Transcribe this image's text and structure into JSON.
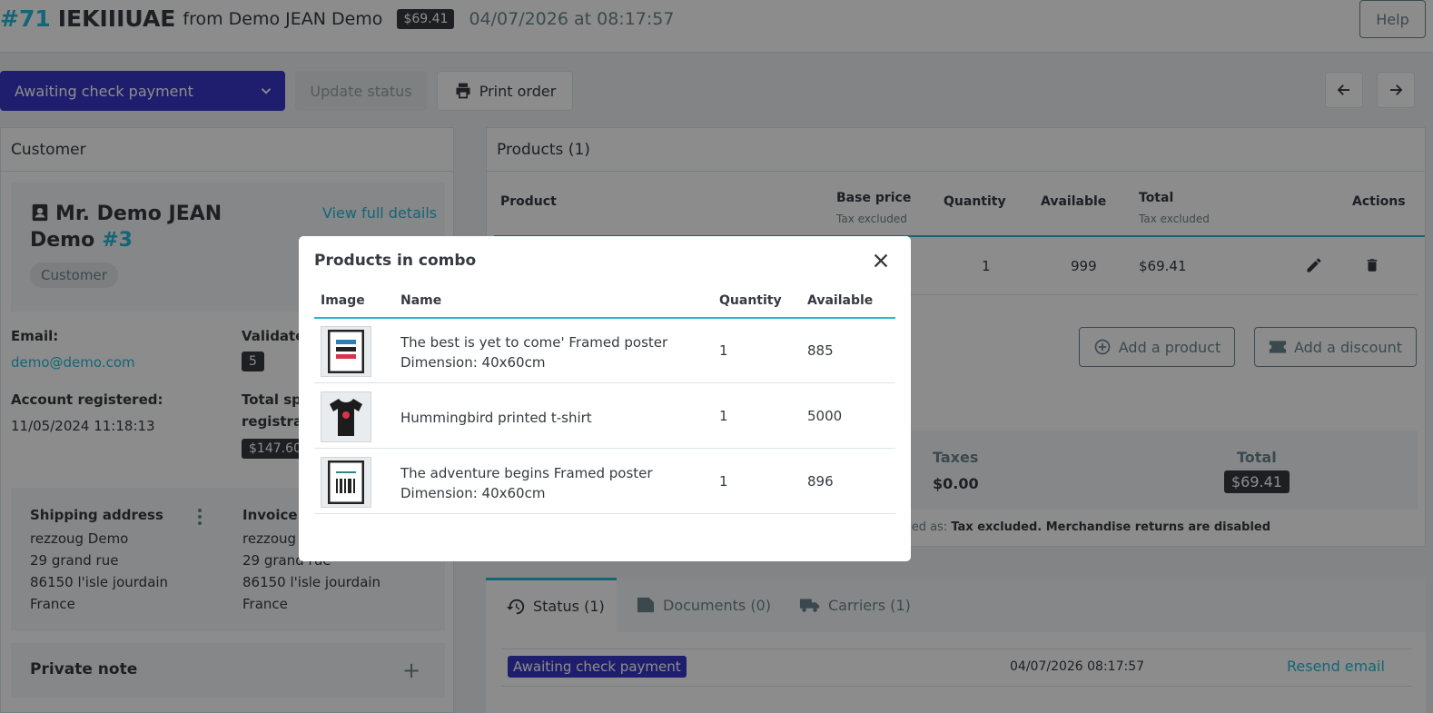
{
  "header": {
    "order_number": "#71",
    "order_reference": "IEKIIIUAE",
    "from_customer": "from Demo JEAN Demo",
    "total_badge": "$69.41",
    "date": "04/07/2026",
    "at_time": "at 08:17:57",
    "help_label": "Help"
  },
  "toolbar": {
    "status_value": "Awaiting check payment",
    "update_status_label": "Update status",
    "print_order_label": "Print order"
  },
  "customer": {
    "card_title": "Customer",
    "name": "Mr. Demo JEAN Demo",
    "id": "#3",
    "view_details": "View full details",
    "group_pill": "Customer",
    "email_label": "Email:",
    "email_value": "demo@demo.com",
    "validated_label": "Validate",
    "validated_value": "5",
    "registered_label": "Account registered:",
    "registered_value": "11/05/2024 11:18:13",
    "total_spent_label_1": "Total sp",
    "total_spent_label_2": "registra",
    "total_spent_value": "$147.60",
    "shipping_title": "Shipping address",
    "shipping_lines": [
      "rezzoug Demo",
      "29 grand rue",
      "86150 l'isle jourdain",
      "France"
    ],
    "invoice_title": "Invoice a",
    "invoice_lines": [
      "rezzoug",
      "29 grand rue",
      "86150 l'isle jourdain",
      "France"
    ],
    "private_note_title": "Private note"
  },
  "products": {
    "card_title": "Products (1)",
    "columns": {
      "product": "Product",
      "base_price": "Base price",
      "base_price_sub": "Tax excluded",
      "quantity": "Quantity",
      "available": "Available",
      "total": "Total",
      "total_sub": "Tax excluded",
      "actions": "Actions"
    },
    "row": {
      "quantity": "1",
      "available": "999",
      "total": "$69.41"
    },
    "add_product_label": "Add a product",
    "add_discount_label": "Add a discount",
    "taxes_label": "Taxes",
    "taxes_value": "$0.00",
    "total_label": "Total",
    "total_value": "$69.41",
    "tax_note_prefix": "yed as: ",
    "tax_note_bold": "Tax excluded. Merchandise returns are disabled"
  },
  "tabs": {
    "status": "Status (1)",
    "documents": "Documents (0)",
    "carriers": "Carriers (1)"
  },
  "history": {
    "status_badge": "Awaiting check payment",
    "date": "04/07/2026 08:17:57",
    "resend_label": "Resend email"
  },
  "modal": {
    "title": "Products in combo",
    "columns": {
      "image": "Image",
      "name": "Name",
      "quantity": "Quantity",
      "available": "Available"
    },
    "rows": [
      {
        "name_1": "The best is yet to come' Framed poster",
        "name_2": "Dimension: 40x60cm",
        "quantity": "1",
        "available": "885"
      },
      {
        "name_1": "Hummingbird printed t-shirt",
        "name_2": "",
        "quantity": "1",
        "available": "5000"
      },
      {
        "name_1": "The adventure begins Framed poster",
        "name_2": "Dimension: 40x60cm",
        "quantity": "1",
        "available": "896"
      }
    ]
  },
  "colors": {
    "accent": "#25b9d7",
    "status_purple": "#3a37c8",
    "dark": "#363a41"
  }
}
